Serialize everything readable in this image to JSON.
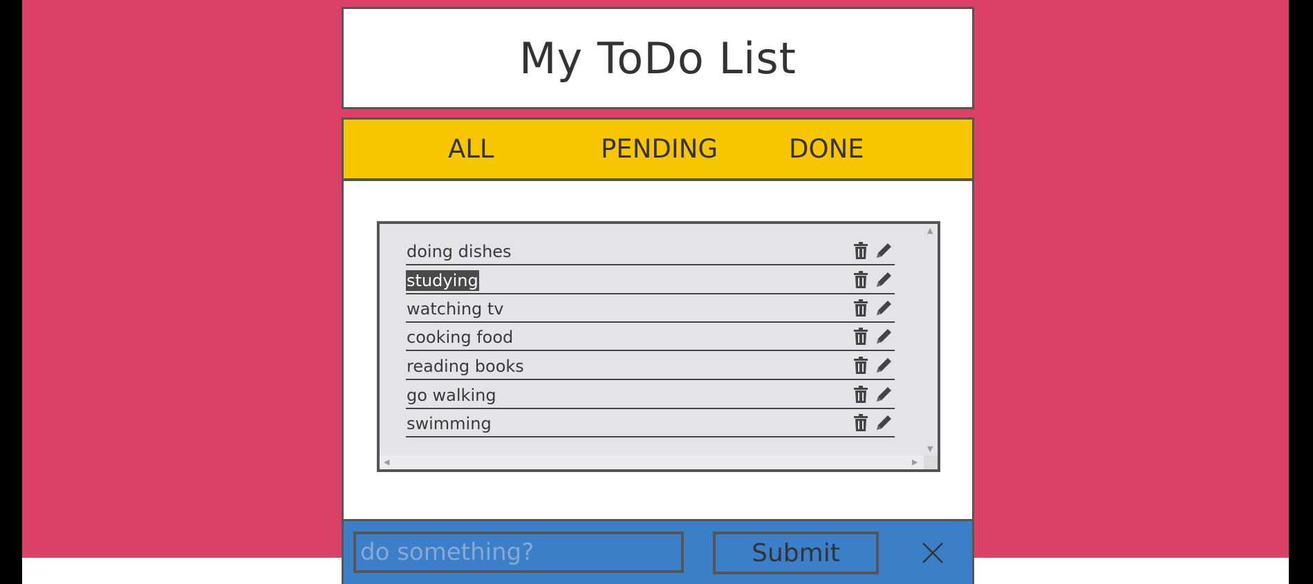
{
  "app": {
    "title": "My ToDo List"
  },
  "filters": [
    {
      "label": "ALL"
    },
    {
      "label": "PENDING"
    },
    {
      "label": "DONE"
    }
  ],
  "todos": [
    {
      "text": "doing dishes",
      "selected": false
    },
    {
      "text": "studying",
      "selected": true
    },
    {
      "text": "watching tv",
      "selected": false
    },
    {
      "text": "cooking food",
      "selected": false
    },
    {
      "text": "reading books",
      "selected": false
    },
    {
      "text": "go walking",
      "selected": false
    },
    {
      "text": "swimming",
      "selected": false
    }
  ],
  "row_icons": {
    "delete": "trash-icon",
    "edit": "pencil-icon"
  },
  "form": {
    "input_placeholder": "do something?",
    "input_value": "",
    "submit_label": "Submit",
    "close_icon": "close-icon"
  },
  "colors": {
    "background": "#db4166",
    "filter_bar": "#f7c600",
    "footer": "#3a7fc8",
    "list_background": "#e4e4e6",
    "border": "#555555"
  }
}
